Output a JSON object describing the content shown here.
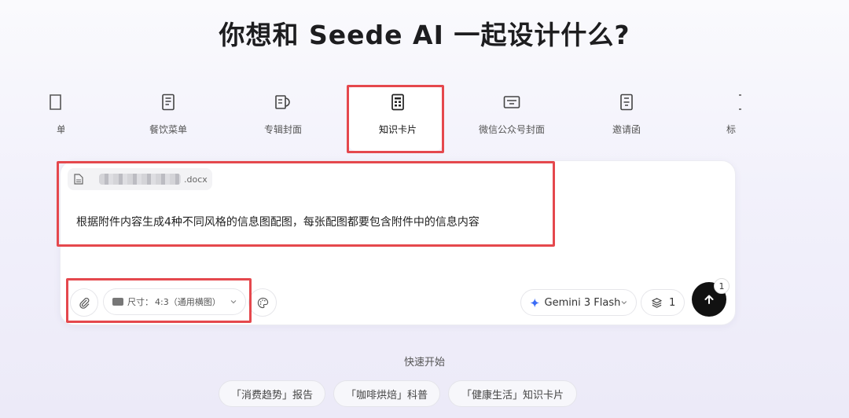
{
  "headline": "你想和 Seede AI 一起设计什么?",
  "categories": [
    {
      "label": "单",
      "icon": "partial-doc-icon"
    },
    {
      "label": "餐饮菜单",
      "icon": "menu-icon"
    },
    {
      "label": "专辑封面",
      "icon": "album-cover-icon"
    },
    {
      "label": "知识卡片",
      "icon": "knowledge-card-icon",
      "active": true
    },
    {
      "label": "微信公众号封面",
      "icon": "wechat-cover-icon"
    },
    {
      "label": "邀请函",
      "icon": "invitation-icon"
    },
    {
      "label": "标",
      "icon": "partial-doc-icon"
    }
  ],
  "attachment": {
    "ext": ".docx",
    "icon": "document-icon"
  },
  "prompt": "根据附件内容生成4种不同风格的信息图配图，每张配图都要包含附件中的信息内容",
  "toolbar": {
    "size_label": "尺寸：",
    "size_value": "4:3（通用横图）",
    "model": "Gemini 3 Flash",
    "layers_count": "1",
    "send_badge": "1"
  },
  "quick_start": {
    "title": "快速开始",
    "chips": [
      "「消费趋势」报告",
      "「咖啡烘焙」科普",
      "「健康生活」知识卡片"
    ]
  },
  "colors": {
    "accent": "#111111",
    "highlight": "#e5484d",
    "model_star": "#3b6cf6"
  }
}
